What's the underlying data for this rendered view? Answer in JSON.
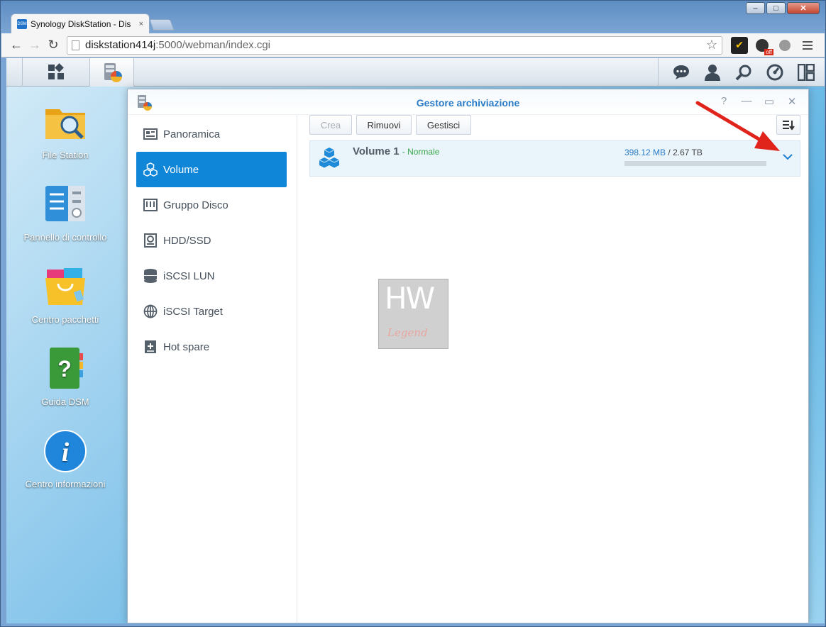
{
  "browser": {
    "tab_title": "Synology DiskStation - Dis",
    "favicon_text": "DSM",
    "tab_close": "×",
    "url_host": "diskstation414j",
    "url_path": ":5000/webman/index.cgi",
    "window_controls": {
      "minimize": "‒",
      "maximize": "□",
      "close": "✕"
    },
    "extensions": {
      "download_badge": "off"
    }
  },
  "dsm": {
    "taskbar": {
      "icons": [
        "main-menu-icon",
        "storage-manager-icon",
        "notifications-icon",
        "user-icon",
        "search-icon",
        "widgets-icon",
        "pilot-view-icon"
      ]
    },
    "desktop": [
      {
        "label": "File Station"
      },
      {
        "label": "Pannello di controllo"
      },
      {
        "label": "Centro pacchetti"
      },
      {
        "label": "Guida DSM"
      },
      {
        "label": "Centro informazioni"
      }
    ],
    "window": {
      "title": "Gestore archiviazione",
      "controls": {
        "help": "?",
        "minimize": "—",
        "maximize": "▭",
        "close": "✕"
      },
      "sidebar": [
        {
          "label": "Panoramica",
          "icon": "overview-icon"
        },
        {
          "label": "Volume",
          "icon": "volume-icon",
          "active": true
        },
        {
          "label": "Gruppo Disco",
          "icon": "disk-group-icon"
        },
        {
          "label": "HDD/SSD",
          "icon": "hdd-icon"
        },
        {
          "label": "iSCSI LUN",
          "icon": "iscsi-lun-icon"
        },
        {
          "label": "iSCSI Target",
          "icon": "iscsi-target-icon"
        },
        {
          "label": "Hot spare",
          "icon": "hot-spare-icon"
        }
      ],
      "toolbar": {
        "create_label": "Crea",
        "remove_label": "Rimuovi",
        "manage_label": "Gestisci",
        "sort_icon": "sort-icon"
      },
      "volume": {
        "name": "Volume 1",
        "status": "- Normale",
        "used": "398.12 MB",
        "separator": " / ",
        "total": "2.67 TB",
        "usage_fraction": 0.0001
      }
    },
    "watermark": {
      "top": "HW",
      "bottom": "Legend"
    }
  },
  "colors": {
    "accent": "#0f86d8",
    "title": "#2a7bc6",
    "status_ok": "#3aa54b",
    "annotation_arrow": "#e0231b"
  }
}
